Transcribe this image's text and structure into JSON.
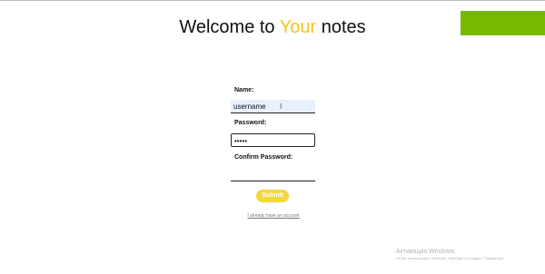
{
  "header": {
    "title_prefix": "Welcome to ",
    "title_highlight": "Your",
    "title_suffix": " notes"
  },
  "form": {
    "name_label": "Name:",
    "name_value": "username",
    "password_label": "Password:",
    "password_value": "•••••",
    "confirm_label": "Confirm Password:",
    "confirm_value": "",
    "submit_label": "Submit",
    "account_link": "I already have an account"
  },
  "watermark": {
    "title": "Активация Windows",
    "subtitle": "Чтобы активировать Windows, перейдите в раздел \"Параметры\"."
  },
  "colors": {
    "accent": "#f5c518",
    "submit": "#f4d738",
    "green_block": "#77b900"
  }
}
